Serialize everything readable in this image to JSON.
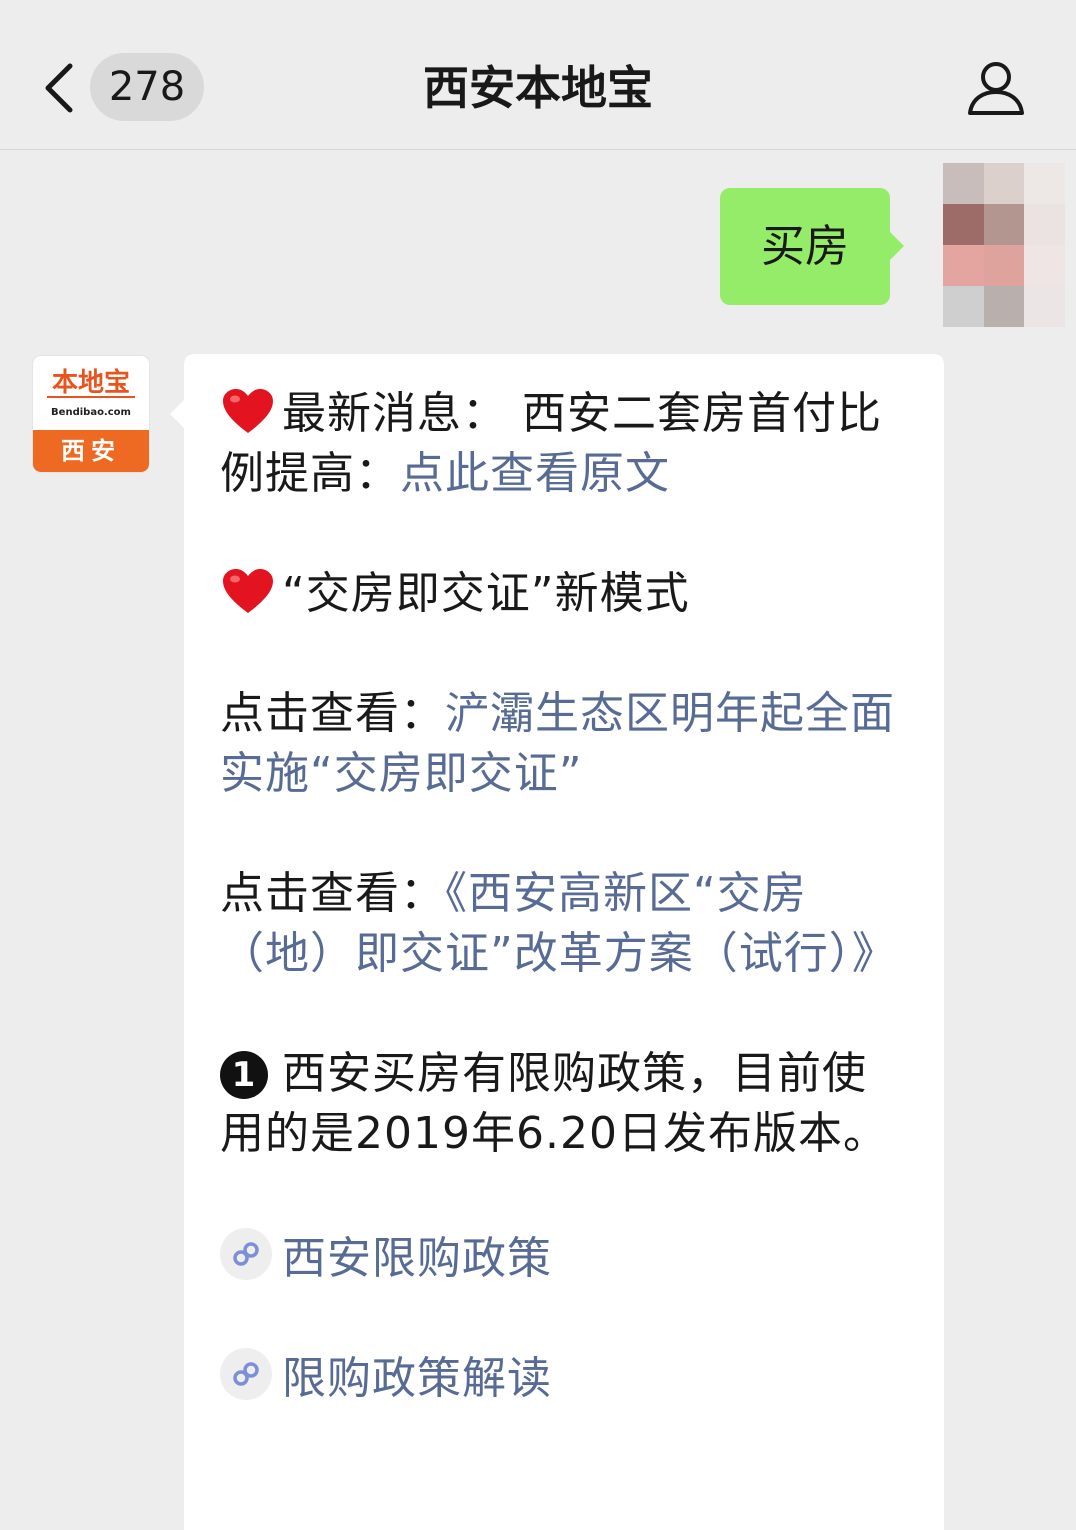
{
  "header": {
    "unread_count": "278",
    "title": "西安本地宝"
  },
  "messages": {
    "outgoing": {
      "text": "买房"
    },
    "incoming": {
      "avatar": {
        "logo_name": "本地宝",
        "logo_domain": "Bendibao.com",
        "logo_city": "西安"
      },
      "news_prefix": "最新消息： 西安二套房首付比例提高：",
      "news_link": "点此查看原文",
      "mode_line": "“交房即交证”新模式",
      "click_label_1": "点击查看：",
      "click_link_1": "浐灞生态区明年起全面实施“交房即交证”",
      "click_label_2": "点击查看：",
      "click_link_2": "《西安高新区“交房（地）即交证”改革方案（试行）》",
      "item_number": "1",
      "policy_text": "西安买房有限购政策，目前使用的是2019年6.20日发布版本。",
      "mini_links": [
        {
          "label": "西安限购政策"
        },
        {
          "label": "限购政策解读"
        }
      ]
    }
  },
  "icons": {
    "back": "chevron-left-icon",
    "profile": "person-icon",
    "heart": "red-heart-icon",
    "mini_program": "mini-program-link-icon"
  },
  "colors": {
    "background": "#ededed",
    "outgoing_bubble": "#95ec69",
    "incoming_bubble": "#ffffff",
    "link": "#576b95",
    "heart": "#e3141f",
    "logo_orange": "#ee6a23"
  }
}
